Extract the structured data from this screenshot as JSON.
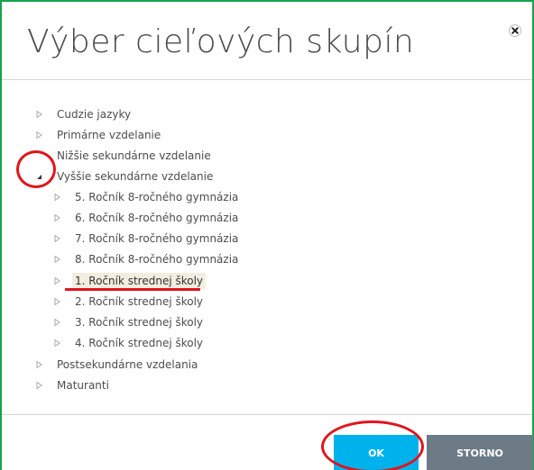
{
  "dialog": {
    "title": "Výber cieľových skupín",
    "close_icon": "close-icon"
  },
  "tree": {
    "nodes": [
      {
        "label": "Cudzie jazyky",
        "expanded": false
      },
      {
        "label": "Primárne vzdelanie",
        "expanded": false
      },
      {
        "label": "Nižšie sekundárne vzdelanie",
        "expanded": false
      },
      {
        "label": "Vyššie sekundárne vzdelanie",
        "expanded": true,
        "children": [
          {
            "label": "5. Ročník 8-ročného gymnázia"
          },
          {
            "label": "6. Ročník 8-ročného gymnázia"
          },
          {
            "label": "7. Ročník 8-ročného gymnázia"
          },
          {
            "label": "8. Ročník 8-ročného gymnázia"
          },
          {
            "label": "1. Ročník strednej školy",
            "selected": true
          },
          {
            "label": "2. Ročník strednej školy"
          },
          {
            "label": "3. Ročník strednej školy"
          },
          {
            "label": "4. Ročník strednej školy"
          }
        ]
      },
      {
        "label": "Postsekundárne vzdelania",
        "expanded": false
      },
      {
        "label": "Maturanti",
        "expanded": false
      }
    ]
  },
  "footer": {
    "ok_label": "OK",
    "storno_label": "STORNO"
  },
  "colors": {
    "dialog_border": "#16a34a",
    "ok_button": "#00b2ec",
    "storno_button": "#6d7b86",
    "selected_bg": "#f3ede0",
    "annotation_red": "#e0151c"
  }
}
